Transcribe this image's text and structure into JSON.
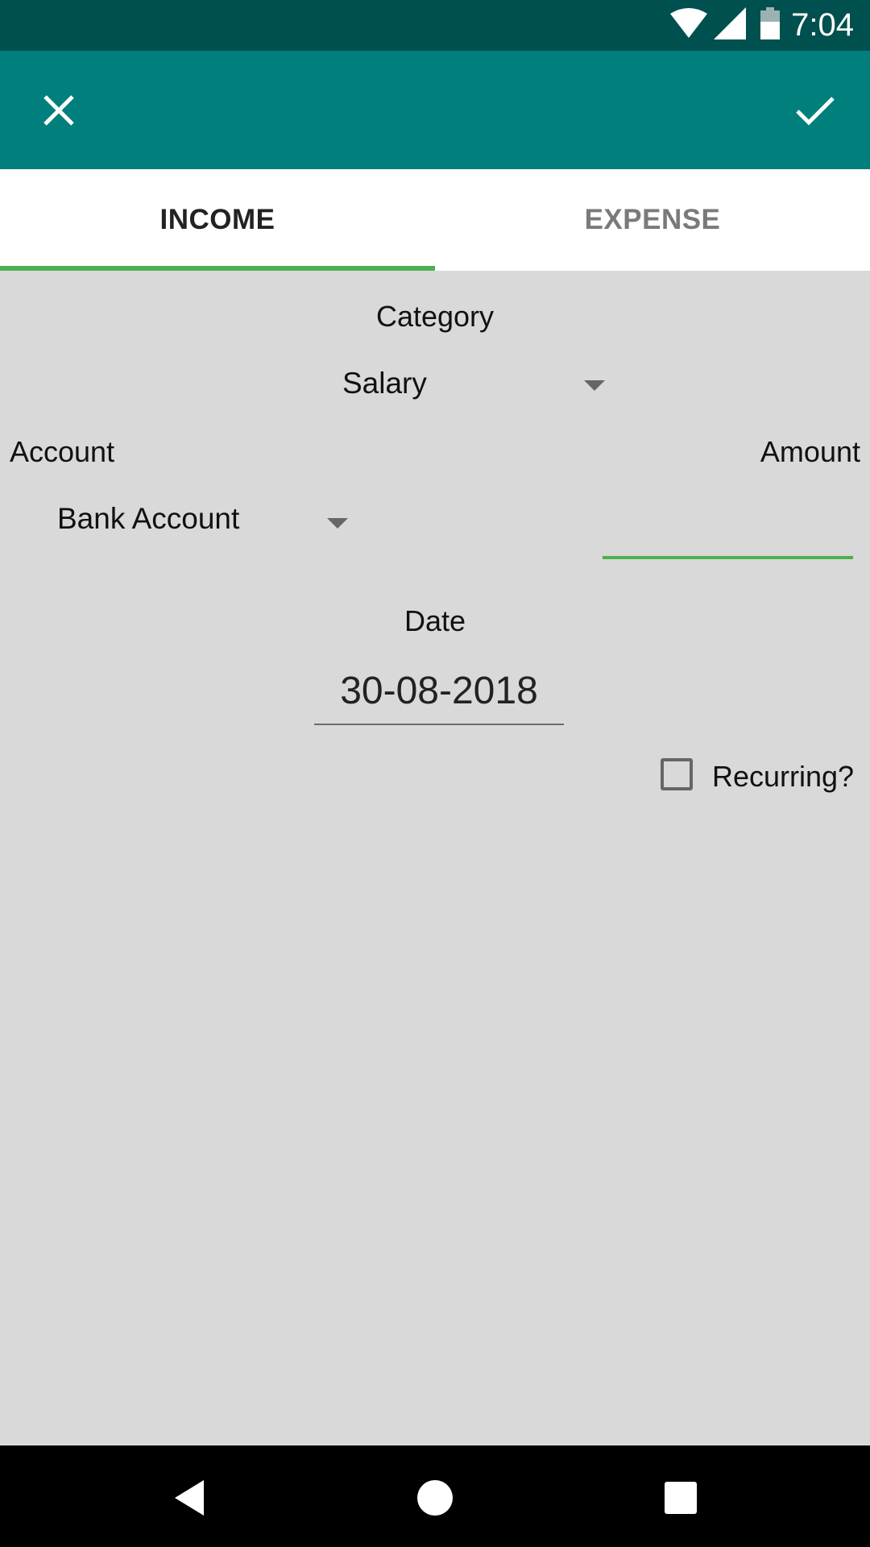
{
  "status_bar": {
    "time": "7:04",
    "icons": [
      "wifi-icon",
      "signal-icon",
      "battery-icon"
    ],
    "background": "#00504f"
  },
  "app_bar": {
    "background": "#007f7c",
    "close_icon": "close-icon",
    "confirm_icon": "check-icon"
  },
  "tabs": {
    "items": [
      {
        "label": "INCOME",
        "selected": true
      },
      {
        "label": "EXPENSE",
        "selected": false
      }
    ],
    "indicator_color": "#4caf50"
  },
  "form": {
    "category_label": "Category",
    "category_value": "Salary",
    "account_label": "Account",
    "account_value": "Bank Account",
    "amount_label": "Amount",
    "amount_value": "",
    "date_label": "Date",
    "date_value": "30-08-2018",
    "recurring_label": "Recurring?",
    "recurring_checked": false
  },
  "nav_bar": {
    "icons": [
      "back-icon",
      "home-icon",
      "recents-icon"
    ]
  }
}
